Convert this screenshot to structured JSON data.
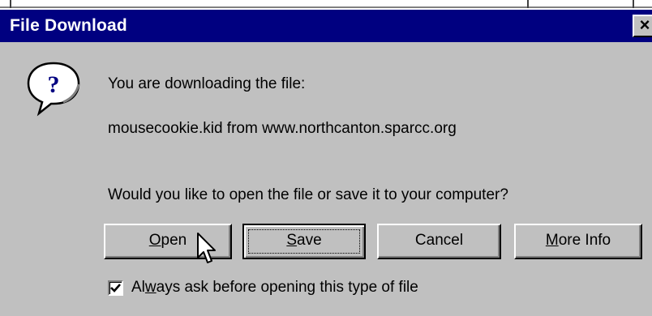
{
  "dialog": {
    "title": "File Download",
    "close_glyph": "×",
    "icon": "question-icon",
    "message_line1": "You are downloading the file:",
    "message_line2": "mousecookie.kid from www.northcanton.sparcc.org",
    "question": "Would you like to open the file or save it to your computer?"
  },
  "buttons": {
    "open": {
      "mnemonic": "O",
      "rest": "pen"
    },
    "save": {
      "mnemonic": "S",
      "rest": "ave"
    },
    "cancel": {
      "label": "Cancel"
    },
    "more_info": {
      "mnemonic": "M",
      "rest": "ore Info"
    }
  },
  "checkbox": {
    "checked": true,
    "label_prefix": "Al",
    "mnemonic": "w",
    "label_suffix": "ays ask before opening this type of file"
  },
  "colors": {
    "titlebar": "#000080",
    "face": "#c0c0c0"
  }
}
